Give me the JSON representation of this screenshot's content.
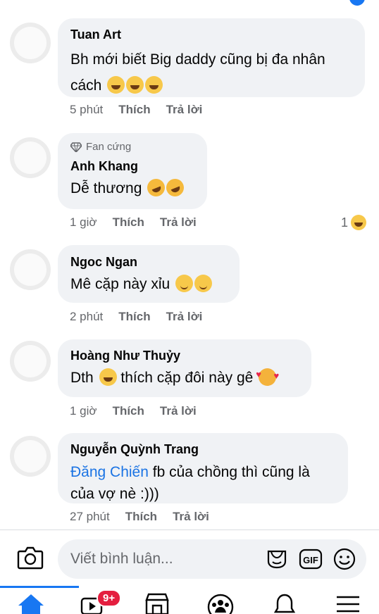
{
  "comments": [
    {
      "avatar_icon": "avatar-image",
      "name": "Tuan Art",
      "text": "Bh mới biết Big daddy cũng bị đa nhân cách",
      "emojis": [
        "laughing-tears-icon",
        "laughing-tears-icon",
        "laughing-tears-icon"
      ],
      "time": "5 phút",
      "like_label": "Thích",
      "reply_label": "Trả lời"
    },
    {
      "avatar_icon": "avatar-image",
      "badge": "Fan cứng",
      "badge_icon": "diamond-icon",
      "name": "Anh Khang",
      "text": "Dễ thương",
      "emojis": [
        "rolling-laughing-icon",
        "rolling-laughing-icon"
      ],
      "time": "1 giờ",
      "like_label": "Thích",
      "reply_label": "Trả lời",
      "reaction_count": "1",
      "reaction_icon": "haha-reaction-icon"
    },
    {
      "avatar_icon": "avatar-image",
      "name": "Ngoc Ngan",
      "text": "Mê cặp này xỉu",
      "emojis": [
        "smiling-blush-icon",
        "smiling-blush-icon"
      ],
      "time": "2 phút",
      "like_label": "Thích",
      "reply_label": "Trả lời"
    },
    {
      "avatar_icon": "avatar-image",
      "name": "Hoàng Như Thuỷy",
      "text_before": "Dth",
      "text_after": "thích cặp đôi này gê",
      "emojis": [
        "laughing-tears-icon",
        "smiling-hearts-icon"
      ],
      "time": "1 giờ",
      "like_label": "Thích",
      "reply_label": "Trả lời"
    },
    {
      "avatar_icon": "avatar-image",
      "name": "Nguyễn Quỳnh Trang",
      "mention": "Đăng Chiến",
      "text": "fb của chồng thì cũng là của vợ nè :)))",
      "time": "27 phút",
      "like_label": "Thích",
      "reply_label": "Trả lời"
    }
  ],
  "composer": {
    "placeholder": "Viết bình luận...",
    "icons": [
      "camera-icon",
      "sticker-icon",
      "gif-icon",
      "emoji-icon"
    ],
    "gif_label": "GIF"
  },
  "tabbar": {
    "icons": [
      "home-icon",
      "watch-icon",
      "marketplace-icon",
      "groups-icon",
      "notifications-icon",
      "menu-icon"
    ],
    "watch_badge": "9+"
  },
  "colors": {
    "accent": "#1877f2",
    "bubble": "#f0f2f5",
    "secondary_text": "#65676b",
    "badge_red": "#e41e3f",
    "mention": "#1b74e4"
  }
}
